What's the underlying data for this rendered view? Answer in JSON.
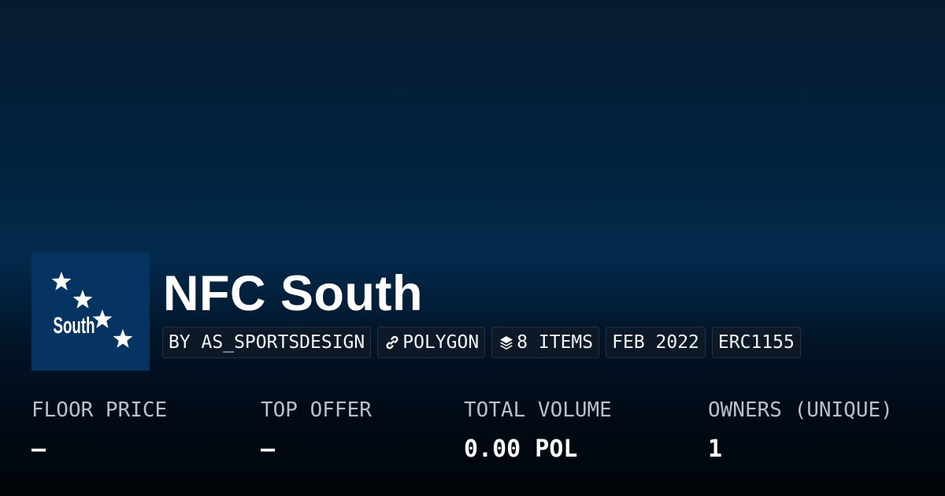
{
  "collection": {
    "title": "NFC South",
    "logo": {
      "icon": "nfc-south-stars-logo",
      "text": "South",
      "background": "#053462"
    }
  },
  "tags": [
    {
      "label": "BY AS_SPORTSDESIGN",
      "icon": null
    },
    {
      "label": "POLYGON",
      "icon": "link-icon"
    },
    {
      "label": "8 ITEMS",
      "icon": "layers-icon"
    },
    {
      "label": "FEB 2022",
      "icon": null
    },
    {
      "label": "ERC1155",
      "icon": null
    }
  ],
  "stats": [
    {
      "label": "FLOOR PRICE",
      "value": "–"
    },
    {
      "label": "TOP OFFER",
      "value": "–"
    },
    {
      "label": "TOTAL VOLUME",
      "value": "0.00 POL"
    },
    {
      "label": "OWNERS (UNIQUE)",
      "value": "1"
    }
  ],
  "colors": {
    "background_top": "#032a4c",
    "background_bottom": "#010509",
    "label": "#b8c0c9",
    "text": "#ffffff"
  }
}
